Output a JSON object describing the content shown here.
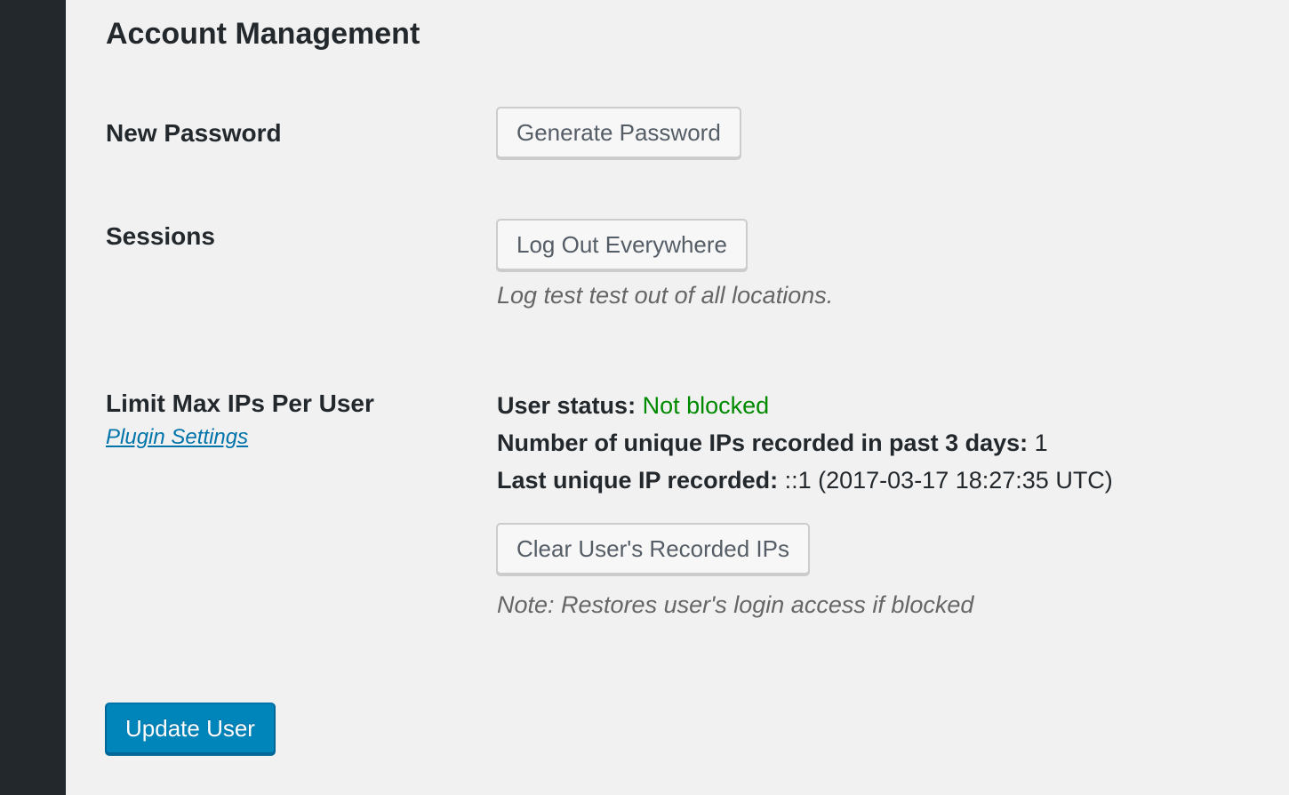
{
  "section": {
    "title": "Account Management"
  },
  "new_password": {
    "label": "New Password",
    "generate_button": "Generate Password"
  },
  "sessions": {
    "label": "Sessions",
    "logout_button": "Log Out Everywhere",
    "description": "Log test test out of all locations."
  },
  "limit_ips": {
    "label": "Limit Max IPs Per User",
    "plugin_link": "Plugin Settings",
    "status_label": "User status:",
    "status_value": "Not blocked",
    "count_label": "Number of unique IPs recorded in past 3 days:",
    "count_value": "1",
    "last_label": "Last unique IP recorded:",
    "last_value": "::1 (2017-03-17 18:27:35 UTC)",
    "clear_button": "Clear User's Recorded IPs",
    "note": "Note: Restores user's login access if blocked"
  },
  "footer": {
    "update_button": "Update User"
  },
  "colors": {
    "sidebar": "#23282d",
    "background": "#f1f1f1",
    "link": "#0073aa",
    "status_ok": "#008a00",
    "primary_button": "#0085ba"
  }
}
